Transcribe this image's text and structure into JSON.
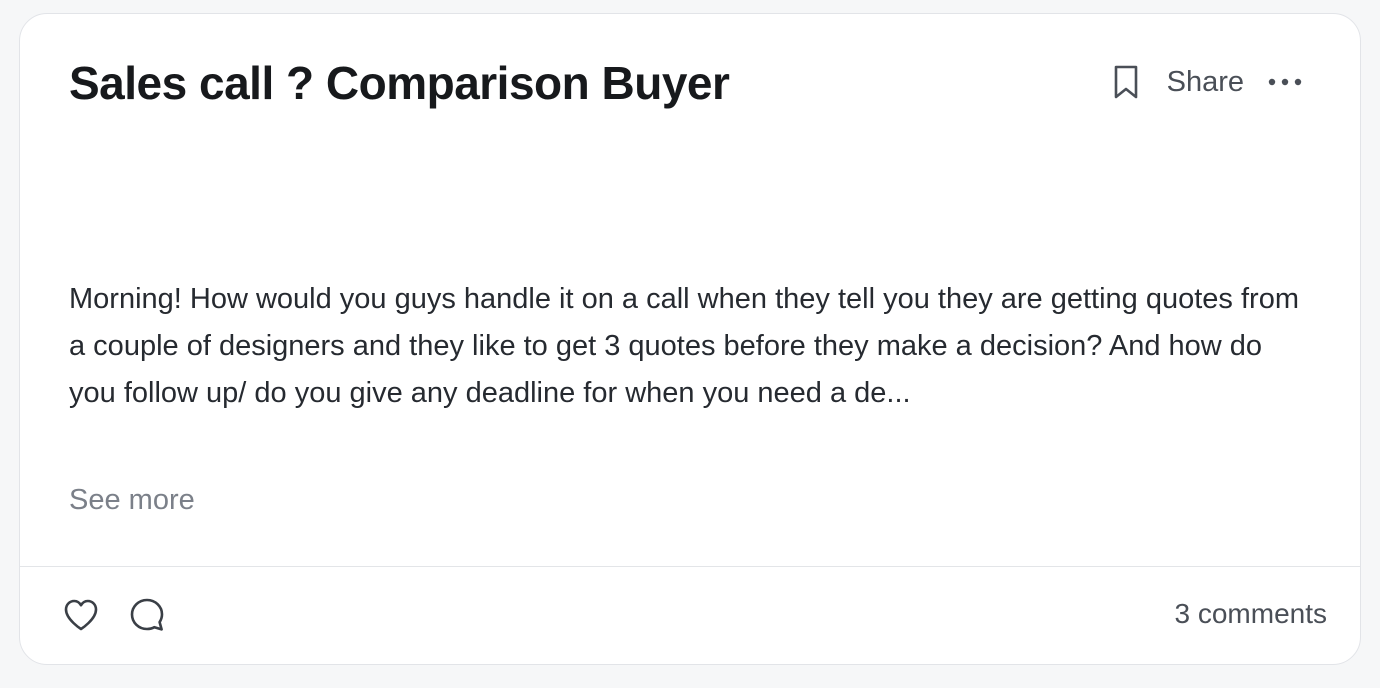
{
  "post": {
    "title": "Sales call ? Comparison Buyer",
    "body": "Morning! How would you guys handle it on a call when they tell you they are getting quotes from a couple of designers and they like to get 3 quotes before they make a decision? And how do you follow up/ do you give any deadline for when you need a de...",
    "see_more_label": "See more"
  },
  "header_actions": {
    "bookmark_icon": "bookmark-icon",
    "share_label": "Share",
    "more_icon": "more-horizontal-icon"
  },
  "footer": {
    "like_icon": "heart-icon",
    "comment_icon": "comment-icon",
    "comments_count_label": "3 comments"
  },
  "colors": {
    "background": "#f6f7f8",
    "card": "#ffffff",
    "title": "#17191c",
    "body_text": "#262a30",
    "muted_text": "#7b8089",
    "icon": "#4a4f57",
    "border": "#e2e4e8"
  }
}
